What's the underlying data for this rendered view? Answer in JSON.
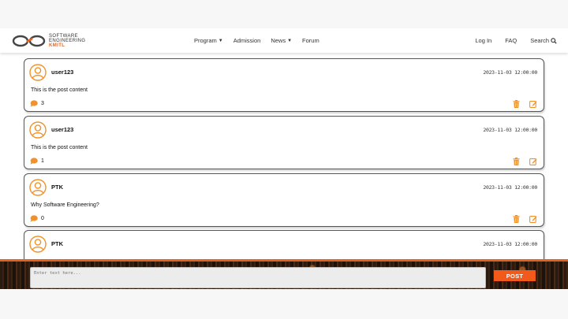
{
  "brand": {
    "line1": "SOFTWARE",
    "line2": "ENGINEERING",
    "line3": "KMITL",
    "accent_color": "#e5641d"
  },
  "nav": {
    "center": [
      {
        "label": "Program",
        "has_dropdown": true
      },
      {
        "label": "Admission",
        "has_dropdown": false
      },
      {
        "label": "News",
        "has_dropdown": true
      },
      {
        "label": "Forum",
        "has_dropdown": false
      }
    ],
    "login_label": "Log In",
    "faq_label": "FAQ",
    "search_label": "Search",
    "search_icon": "search-icon"
  },
  "posts": [
    {
      "username": "user123",
      "timestamp": "2023-11-03 12:00:00",
      "content": "This is the post content",
      "comment_count": "3"
    },
    {
      "username": "user123",
      "timestamp": "2023-11-03 12:00:00",
      "content": "This is the post content",
      "comment_count": "1"
    },
    {
      "username": "PTK",
      "timestamp": "2023-11-03 12:00:00",
      "content": "Why Software Engineering?",
      "comment_count": "0"
    },
    {
      "username": "PTK",
      "timestamp": "2023-11-03 12:00:00",
      "content": "",
      "comment_count": ""
    }
  ],
  "icons": {
    "avatar": "user-circle-icon",
    "comment": "comment-icon",
    "delete": "trash-icon",
    "edit": "edit-icon",
    "accent_color": "#f0922b"
  },
  "compose": {
    "placeholder": "Enter text here...",
    "post_label": "POST",
    "button_color": "#f15a1a"
  }
}
